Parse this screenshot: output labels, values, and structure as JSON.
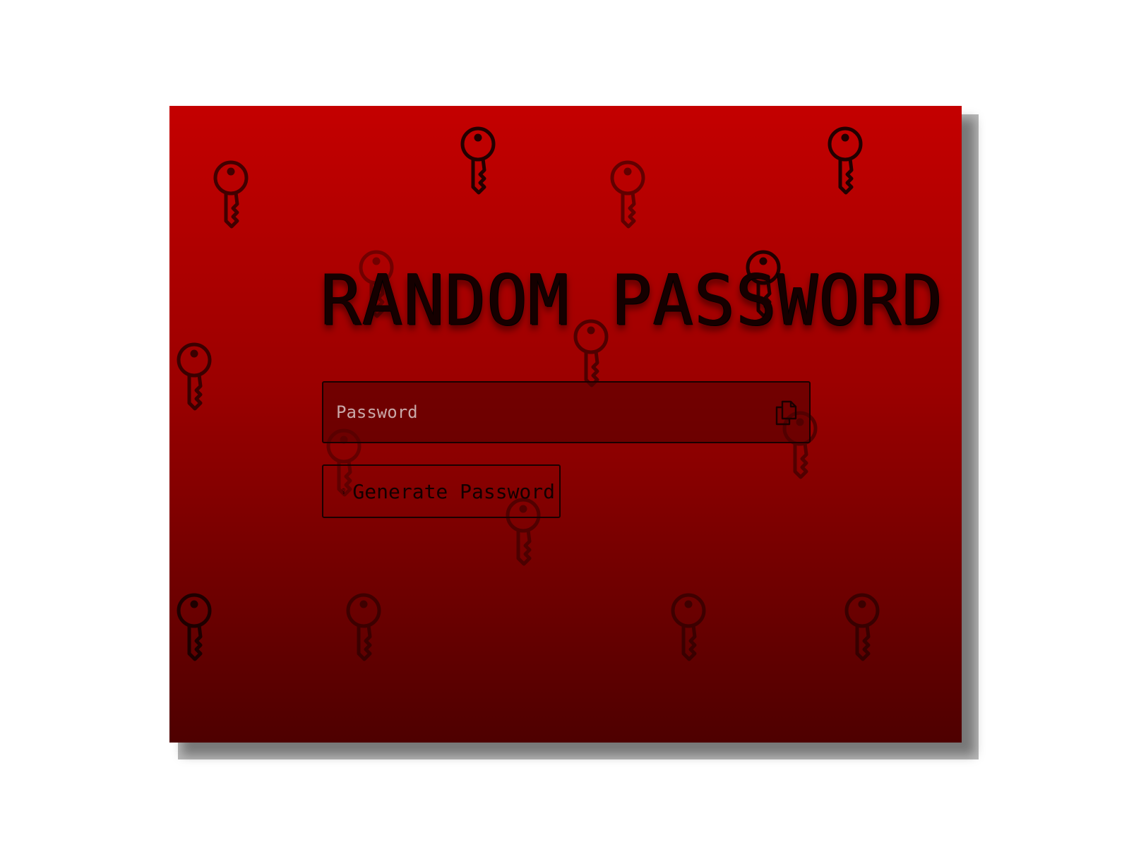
{
  "app": {
    "title": "RANDOM PASSWORD"
  },
  "password_field": {
    "value": "",
    "placeholder": "Password",
    "copy_icon": "copy-icon"
  },
  "generate_button": {
    "label": "Generate Password",
    "icon": "key-icon"
  },
  "background": {
    "pattern_icon": "key-icon",
    "gradient_top": "#c40000",
    "gradient_bottom": "#4e0000"
  }
}
